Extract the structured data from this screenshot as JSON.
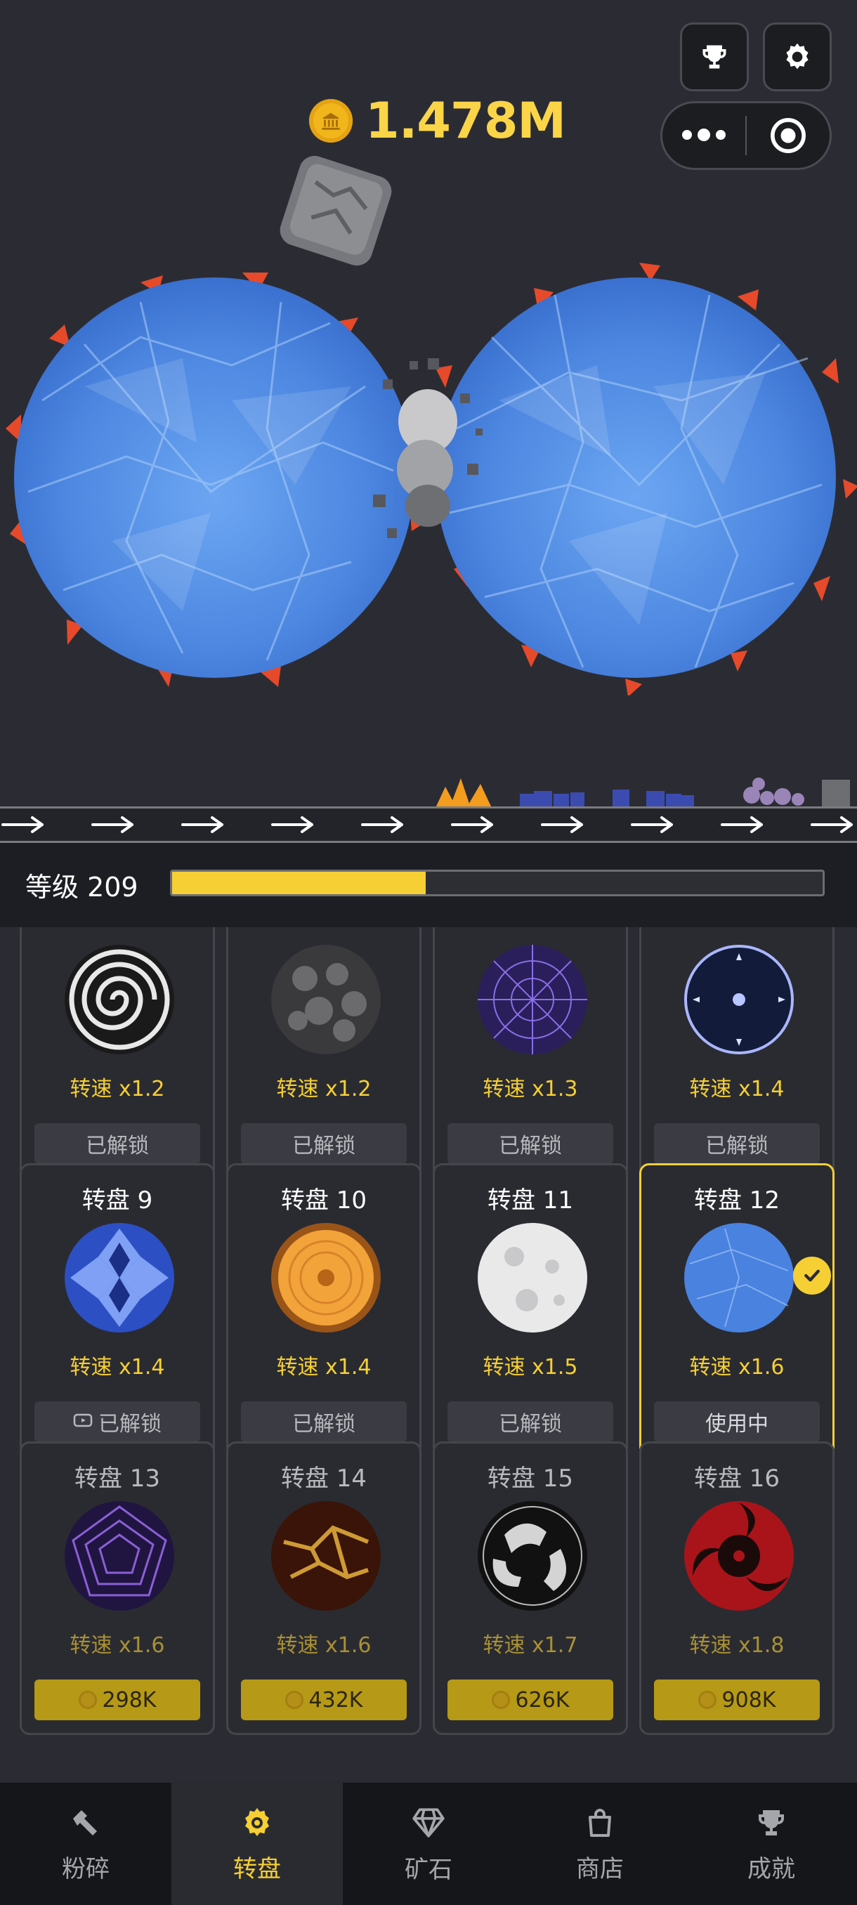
{
  "header": {
    "coins": "1.478M"
  },
  "icons": {
    "trophy": "trophy-icon",
    "settings": "gear-icon",
    "menu": "more-dots-icon",
    "close": "target-icon"
  },
  "level": {
    "label": "等级 209",
    "progress": 0.39
  },
  "wheels": [
    {
      "name": "",
      "speed": "转速 x1.2",
      "button": "已解锁",
      "state": "unlocked",
      "style": "spiral"
    },
    {
      "name": "",
      "speed": "转速 x1.2",
      "button": "已解锁",
      "state": "unlocked",
      "style": "rocks"
    },
    {
      "name": "",
      "speed": "转速 x1.3",
      "button": "已解锁",
      "state": "unlocked",
      "style": "purple-swirl"
    },
    {
      "name": "",
      "speed": "转速 x1.4",
      "button": "已解锁",
      "state": "unlocked",
      "style": "dark-gear"
    },
    {
      "name": "转盘 9",
      "speed": "转速 x1.4",
      "button": "已解锁",
      "state": "unlocked",
      "style": "blue-tiles"
    },
    {
      "name": "转盘 10",
      "speed": "转速 x1.4",
      "button": "已解锁",
      "state": "unlocked",
      "style": "wood"
    },
    {
      "name": "转盘 11",
      "speed": "转速 x1.5",
      "button": "已解锁",
      "state": "unlocked",
      "style": "moon"
    },
    {
      "name": "转盘 12",
      "speed": "转速 x1.6",
      "button": "使用中",
      "state": "active",
      "style": "ice"
    },
    {
      "name": "转盘 13",
      "speed": "转速 x1.6",
      "button": "298K",
      "state": "locked",
      "style": "violet-vortex"
    },
    {
      "name": "转盘 14",
      "speed": "转速 x1.6",
      "button": "432K",
      "state": "locked",
      "style": "lava"
    },
    {
      "name": "转盘 15",
      "speed": "转速 x1.7",
      "button": "626K",
      "state": "locked",
      "style": "white-beasts"
    },
    {
      "name": "转盘 16",
      "speed": "转速 x1.8",
      "button": "908K",
      "state": "locked",
      "style": "red-tomoe"
    }
  ],
  "nav": [
    {
      "label": "粉碎",
      "icon": "hammer-icon"
    },
    {
      "label": "转盘",
      "icon": "gear-icon",
      "active": true
    },
    {
      "label": "矿石",
      "icon": "diamond-icon"
    },
    {
      "label": "商店",
      "icon": "shopping-bag-icon"
    },
    {
      "label": "成就",
      "icon": "trophy-icon"
    }
  ],
  "colors": {
    "background": "#2b2c33",
    "accent": "#f6cf34",
    "wheel_blue": "#4a82e0"
  }
}
